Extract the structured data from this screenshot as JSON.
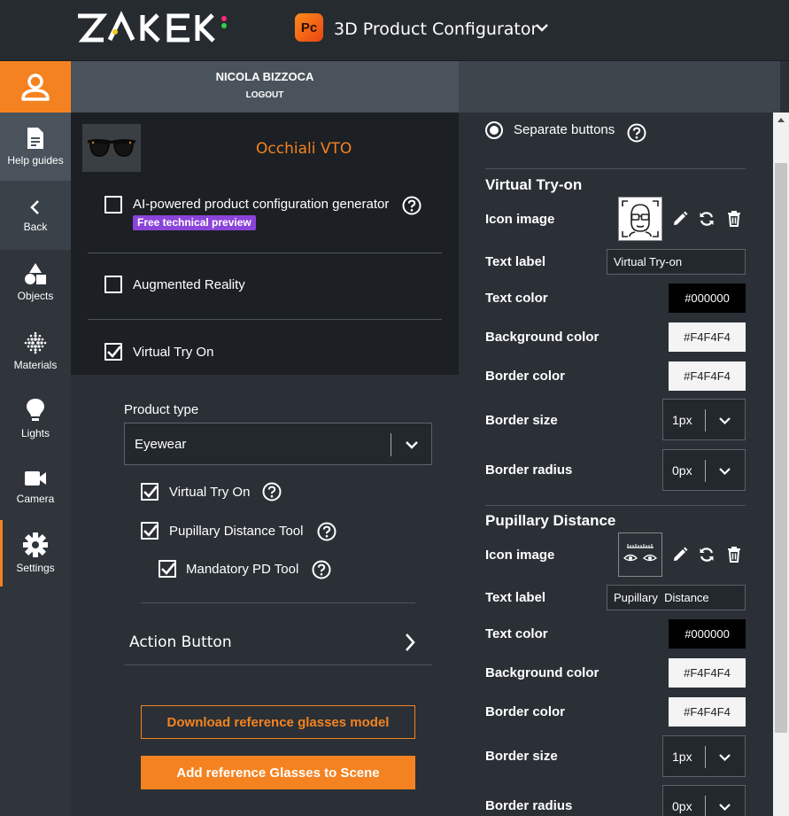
{
  "app": {
    "logo": "ZAKEKE",
    "badge": "Pc",
    "title": "3D Product Configurator"
  },
  "user": {
    "name": "NICOLA BIZZOCA",
    "logout": "LOGOUT"
  },
  "sidebar": {
    "items": [
      {
        "label": "Help guides",
        "icon": "document-icon"
      },
      {
        "label": "Back",
        "icon": "chevron-left-icon"
      },
      {
        "label": "Objects",
        "icon": "shapes-icon"
      },
      {
        "label": "Materials",
        "icon": "dots-grid-icon"
      },
      {
        "label": "Lights",
        "icon": "lightbulb-icon"
      },
      {
        "label": "Camera",
        "icon": "video-camera-icon"
      },
      {
        "label": "Settings",
        "icon": "gear-icon"
      }
    ]
  },
  "product": {
    "name": "Occhiali VTO"
  },
  "options": {
    "ai": {
      "label": "AI-powered product configuration generator",
      "badge": "Free technical preview",
      "checked": false
    },
    "ar": {
      "label": "Augmented Reality",
      "checked": false
    },
    "vto": {
      "label": "Virtual Try On",
      "checked": true
    }
  },
  "vto_panel": {
    "product_type_label": "Product type",
    "product_type_value": "Eyewear",
    "sub_vto": {
      "label": "Virtual Try On",
      "checked": true
    },
    "pd_tool": {
      "label": "Pupillary Distance Tool",
      "checked": true
    },
    "mandatory_pd": {
      "label": "Mandatory PD Tool",
      "checked": true
    },
    "action_button": "Action Button",
    "download_btn": "Download reference glasses model",
    "add_btn": "Add reference Glasses to Scene"
  },
  "right": {
    "radio_label": "Separate buttons",
    "labels": {
      "icon_image": "Icon image",
      "text_label": "Text label",
      "text_color": "Text color",
      "background_color": "Background color",
      "border_color": "Border color",
      "border_size": "Border size",
      "border_radius": "Border radius"
    },
    "vto": {
      "title": "Virtual Try-on",
      "text_label": "Virtual Try-on",
      "text_color": "#000000",
      "background_color": "#F4F4F4",
      "border_color": "#F4F4F4",
      "border_size": "1px",
      "border_radius": "0px"
    },
    "pd": {
      "title": "Pupillary Distance",
      "text_label": "Pupillary  Distance",
      "text_color": "#000000",
      "background_color": "#F4F4F4",
      "border_color": "#F4F4F4",
      "border_size": "1px",
      "border_radius": "0px"
    }
  },
  "colors": {
    "accent": "#F58220",
    "badge": "#8B44D9"
  }
}
